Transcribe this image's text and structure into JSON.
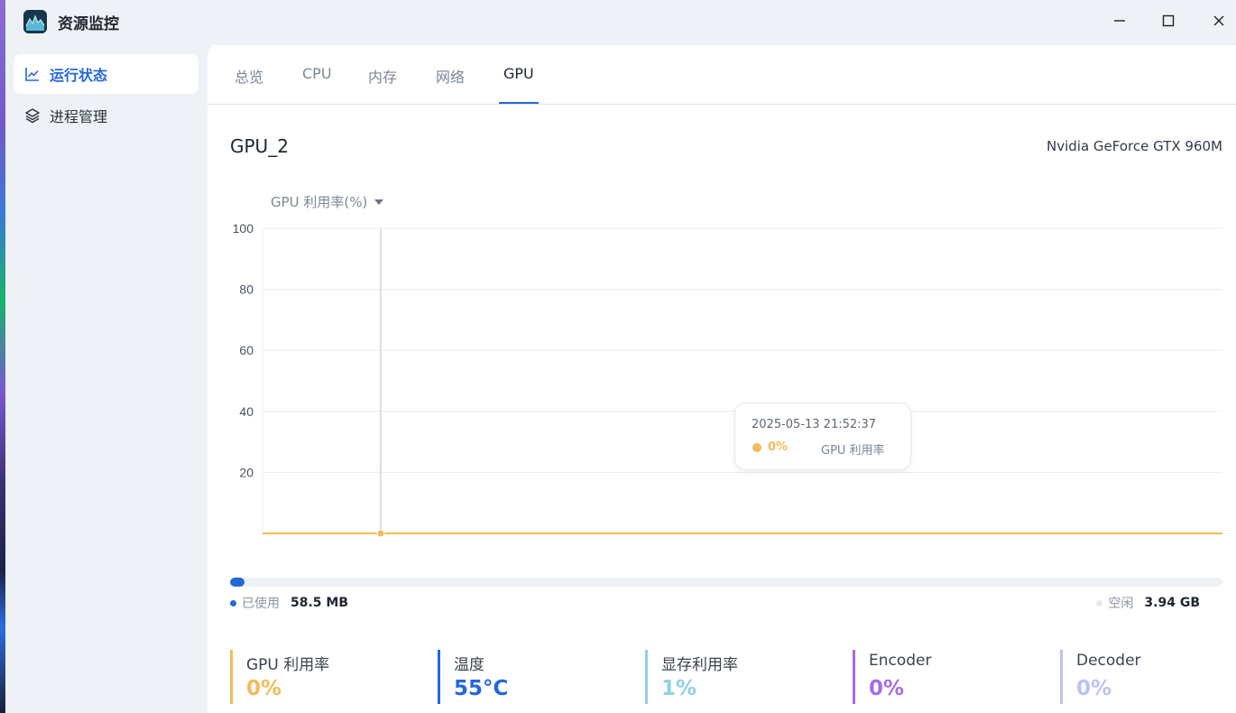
{
  "app": {
    "title": "资源监控"
  },
  "sidebar": {
    "items": [
      {
        "label": "运行状态",
        "icon": "line-chart-icon",
        "active": true
      },
      {
        "label": "进程管理",
        "icon": "layers-icon",
        "active": false
      }
    ]
  },
  "tabs": [
    {
      "label": "总览"
    },
    {
      "label": "CPU"
    },
    {
      "label": "内存"
    },
    {
      "label": "网络"
    },
    {
      "label": "GPU"
    }
  ],
  "active_tab": "GPU",
  "gpu": {
    "name": "GPU_2",
    "model": "Nvidia GeForce GTX 960M",
    "metric_selector": "GPU 利用率(%)"
  },
  "chart_data": {
    "type": "line",
    "ylim": [
      0,
      100
    ],
    "yticks": [
      "100",
      "80",
      "60",
      "40",
      "20"
    ],
    "series": [
      {
        "name": "GPU 利用率",
        "values": [
          0,
          0,
          0,
          0,
          0,
          0,
          0,
          0,
          0,
          0
        ]
      }
    ],
    "color": "#f2bb5a",
    "tooltip": {
      "time": "2025-05-13 21:52:37",
      "value": "0%",
      "series": "GPU 利用率"
    }
  },
  "memory": {
    "used_label": "已使用",
    "used_value": "58.5 MB",
    "free_label": "空闲",
    "free_value": "3.94 GB",
    "used_fraction": 0.0145,
    "used_color": "#2468d8",
    "free_color": "#e6eaf0"
  },
  "stats": [
    {
      "label": "GPU 利用率",
      "value": "0%",
      "color": "#f2bb5a"
    },
    {
      "label": "温度",
      "value": "55°C",
      "color": "#2468d8"
    },
    {
      "label": "显存利用率",
      "value": "1%",
      "color": "#8fd0e8"
    },
    {
      "label": "Encoder",
      "value": "0%",
      "color": "#a56de2"
    },
    {
      "label": "Decoder",
      "value": "0%",
      "color": "#b9c3f5"
    }
  ]
}
